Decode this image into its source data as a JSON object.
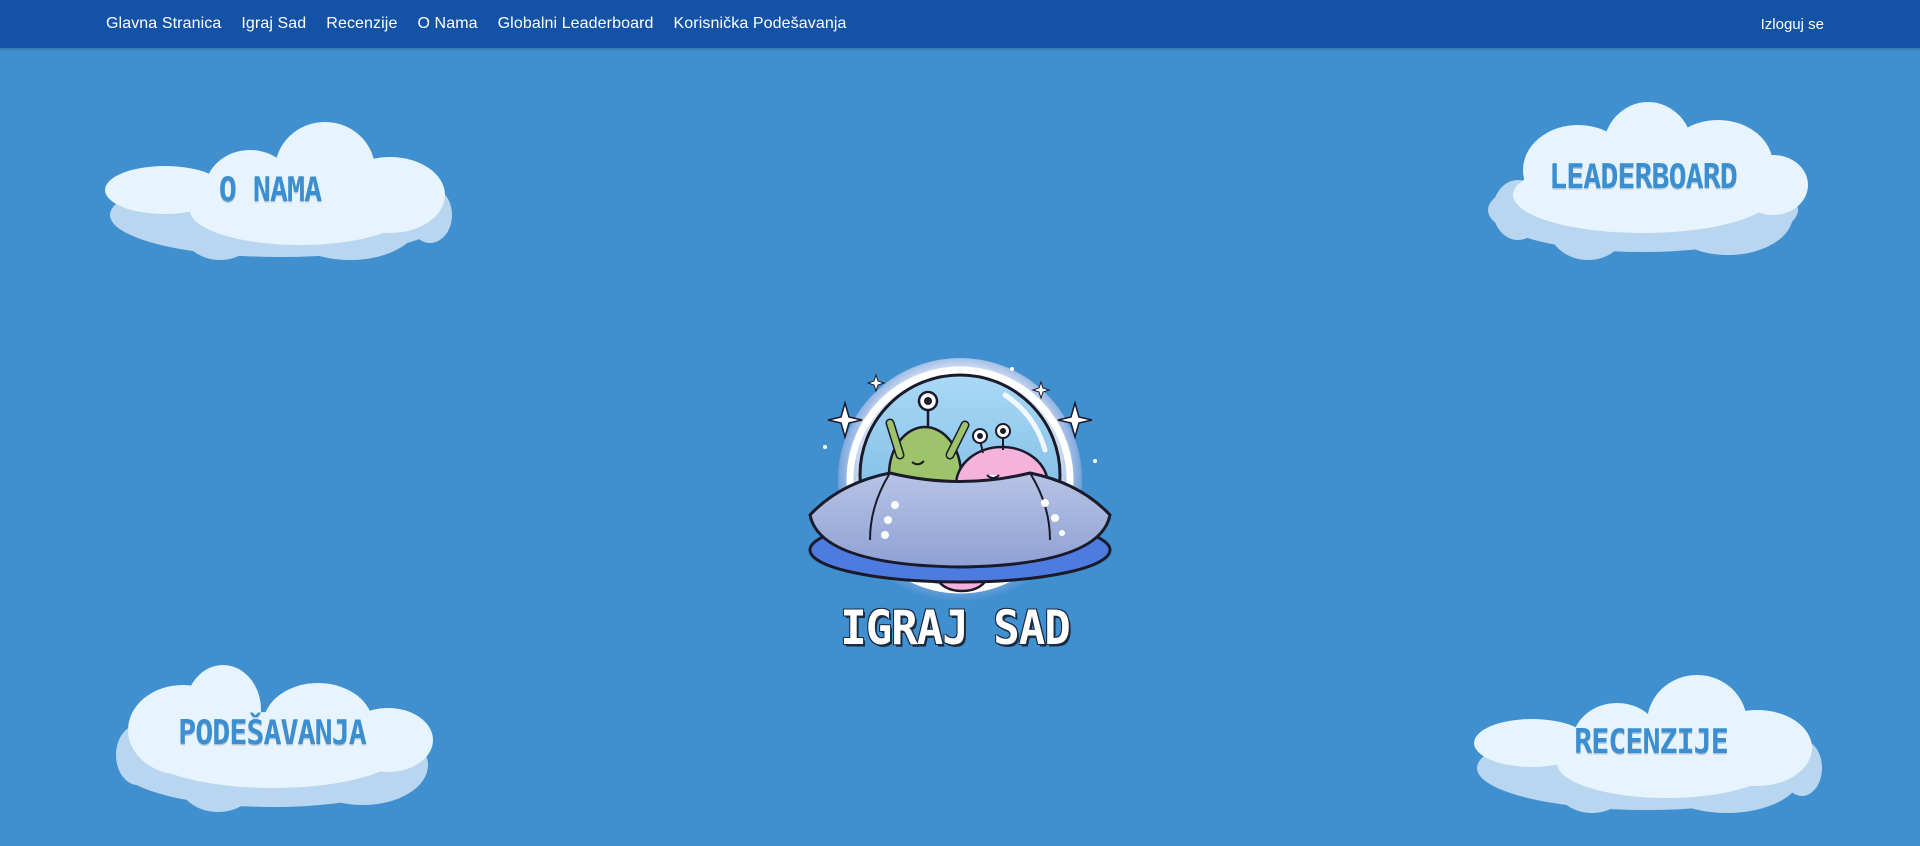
{
  "nav": {
    "items": [
      {
        "label": "Glavna Stranica"
      },
      {
        "label": "Igraj Sad"
      },
      {
        "label": "Recenzije"
      },
      {
        "label": "O Nama"
      },
      {
        "label": "Globalni Leaderboard"
      },
      {
        "label": "Korisnička Podešavanja"
      }
    ],
    "logout": "Izloguj se"
  },
  "clouds": {
    "about": "O NAMA",
    "leaderboard": "LEADERBOARD",
    "settings": "PODEŠAVANJA",
    "reviews": "RECENZIJE"
  },
  "play": {
    "label": "IGRAJ SAD"
  },
  "colors": {
    "background": "#4090d0",
    "navbar": "#1452a6",
    "cloud_text": "#3b8fd0"
  }
}
